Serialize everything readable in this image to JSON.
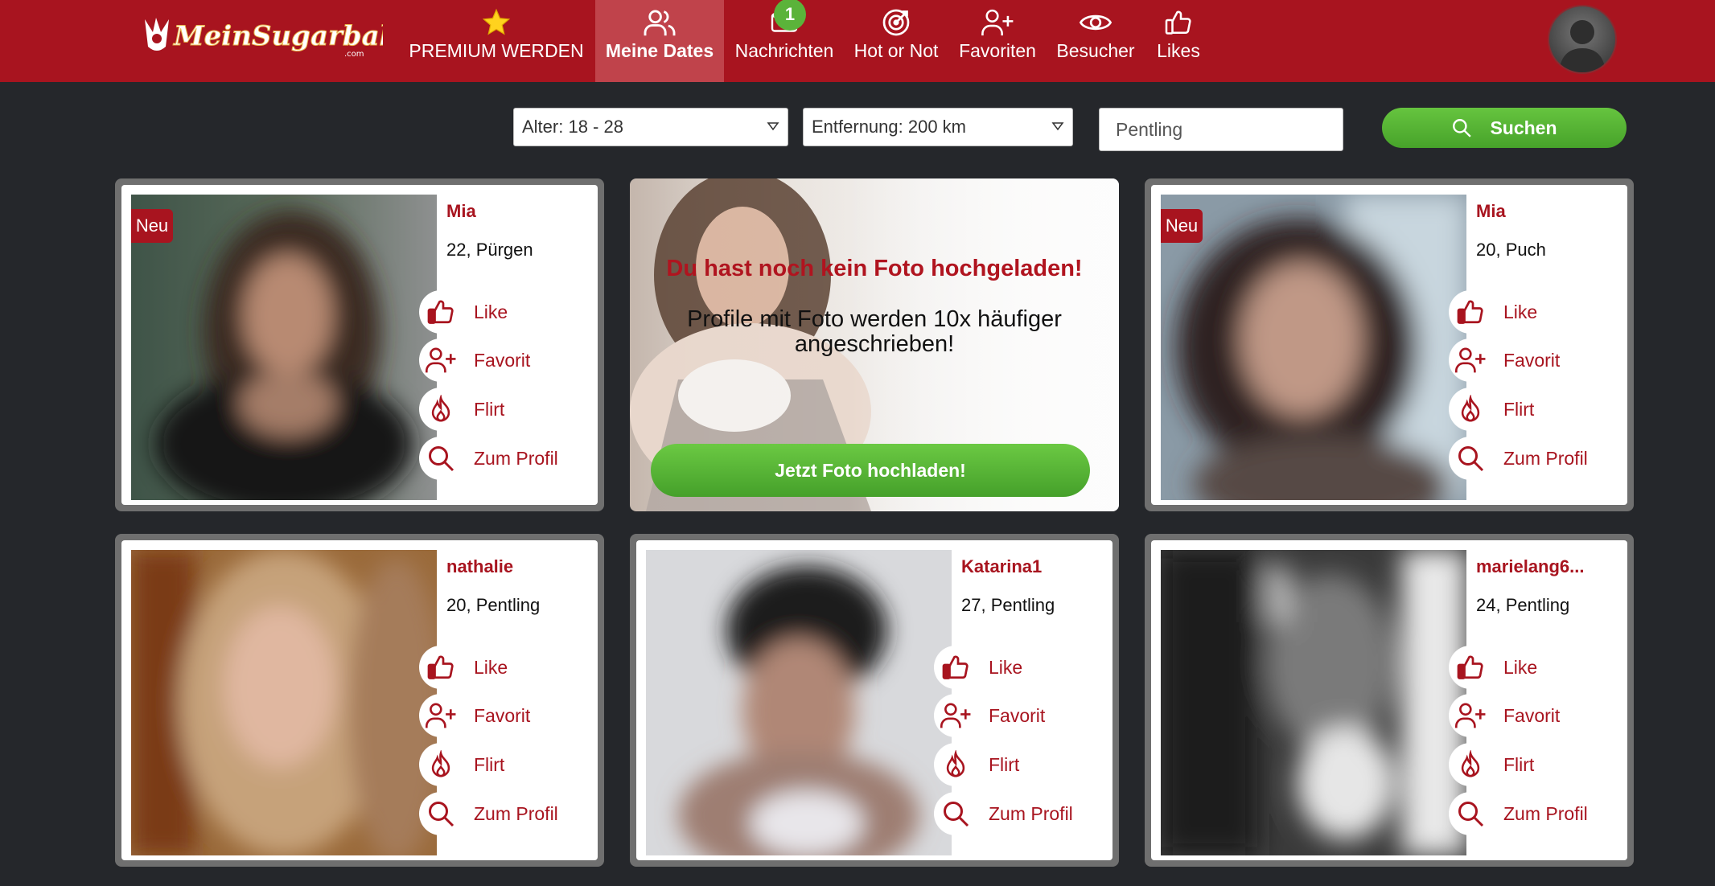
{
  "header": {
    "logo_text": "MeinSugarbabe.com",
    "nav": [
      {
        "id": "premium",
        "label": "PREMIUM WERDEN",
        "icon": "star-icon"
      },
      {
        "id": "dates",
        "label": "Meine Dates",
        "icon": "users-icon",
        "active": true
      },
      {
        "id": "messages",
        "label": "Nachrichten",
        "icon": "envelope-icon",
        "badge": "1"
      },
      {
        "id": "hotornot",
        "label": "Hot or Not",
        "icon": "target-icon"
      },
      {
        "id": "favorites",
        "label": "Favoriten",
        "icon": "user-plus-icon"
      },
      {
        "id": "visitors",
        "label": "Besucher",
        "icon": "eye-icon"
      },
      {
        "id": "likes",
        "label": "Likes",
        "icon": "thumbs-up-icon"
      }
    ]
  },
  "filters": {
    "age": "Alter: 18 - 28",
    "distance": "Entfernung: 200 km",
    "location_value": "Pentling",
    "search_label": "Suchen"
  },
  "actions": {
    "like": "Like",
    "favorite": "Favorit",
    "flirt": "Flirt",
    "profile": "Zum Profil"
  },
  "promo": {
    "headline": "Du hast noch kein Foto hochgeladen!",
    "text": "Profile mit Foto werden 10x häufiger angeschrieben!",
    "button": "Jetzt Foto hochladen!"
  },
  "profiles": [
    {
      "name": "Mia",
      "meta": "22, Pürgen",
      "badge": "Neu"
    },
    {
      "name": "Mia",
      "meta": "20, Puch",
      "badge": "Neu"
    },
    {
      "name": "nathalie",
      "meta": "20, Pentling",
      "badge": ""
    },
    {
      "name": "Katarina1",
      "meta": "27, Pentling",
      "badge": ""
    },
    {
      "name": "marielang6...",
      "meta": "24, Pentling",
      "badge": ""
    }
  ],
  "colors": {
    "brand_red": "#a8141f",
    "green": "#5bb33a",
    "background": "#25272b"
  }
}
